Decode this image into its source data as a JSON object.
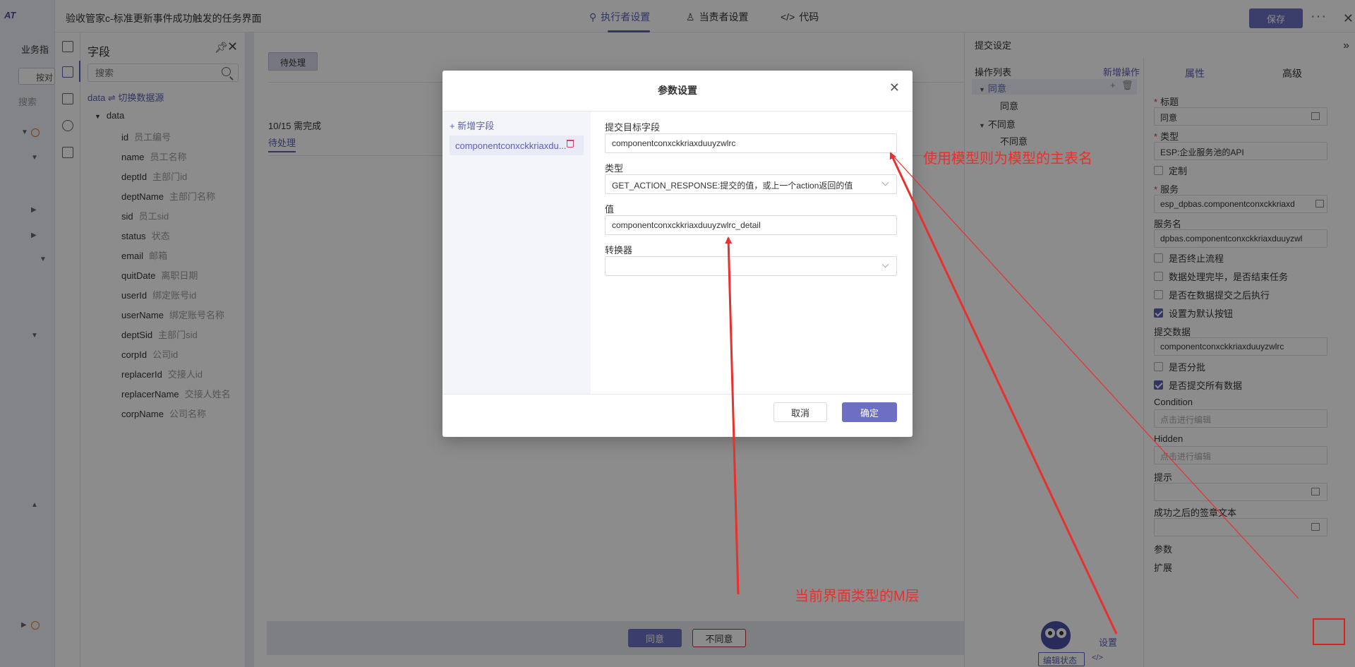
{
  "app": {
    "logo_text": "AT",
    "title": "验收管家c-标准更新事件成功触发的任务界面",
    "tabs": [
      {
        "label": "执行者设置",
        "icon": "executor-icon",
        "active": true
      },
      {
        "label": "当责者设置",
        "icon": "person-icon",
        "active": false
      },
      {
        "label": "代码",
        "icon": "code-icon",
        "active": false
      }
    ],
    "save_label": "保存",
    "more_label": "···",
    "close_label": "✕"
  },
  "left_nav": {
    "section_label": "业务指",
    "button_label": "按对",
    "search_placeholder": "搜索"
  },
  "field_panel": {
    "title": "字段",
    "search_placeholder": "搜索",
    "datasource_label": "data ⇌ 切换数据源",
    "root_label": "data",
    "fields": [
      {
        "name": "id",
        "desc": "员工编号"
      },
      {
        "name": "name",
        "desc": "员工名称"
      },
      {
        "name": "deptId",
        "desc": "主部门id"
      },
      {
        "name": "deptName",
        "desc": "主部门名称"
      },
      {
        "name": "sid",
        "desc": "员工sid"
      },
      {
        "name": "status",
        "desc": "状态"
      },
      {
        "name": "email",
        "desc": "邮箱"
      },
      {
        "name": "quitDate",
        "desc": "离职日期"
      },
      {
        "name": "userId",
        "desc": "绑定账号id"
      },
      {
        "name": "userName",
        "desc": "绑定账号名称"
      },
      {
        "name": "deptSid",
        "desc": "主部门sid"
      },
      {
        "name": "corpId",
        "desc": "公司id"
      },
      {
        "name": "replacerId",
        "desc": "交接人id"
      },
      {
        "name": "replacerName",
        "desc": "交接人姓名"
      },
      {
        "name": "corpName",
        "desc": "公司名称"
      }
    ]
  },
  "canvas": {
    "chip_label": "待处理",
    "progress_text": "10/15 需完成",
    "tab_label": "待处理",
    "agree_label": "同意",
    "disagree_label": "不同意"
  },
  "right_panel": {
    "title": "提交设定",
    "op_list_title": "操作列表",
    "op_add_label": "新增操作",
    "ops": [
      {
        "label": "同意",
        "selected": true
      },
      {
        "label": "同意",
        "child": true
      },
      {
        "label": "不同意",
        "selected": false
      },
      {
        "label": "不同意",
        "child": true
      }
    ],
    "tab_attr": "属性",
    "tab_adv": "高级",
    "title_label": "标题",
    "title_value": "同意",
    "type_label": "类型",
    "type_value": "ESP:企业服务池的API",
    "custom_label": "定制",
    "service_label": "服务",
    "service_value": "esp_dpbas.componentconxckkriaxd",
    "service_name_label": "服务名",
    "service_name_value": "dpbas.componentconxckkriaxduuyzwl",
    "terminate_label": "是否终止流程",
    "finish_task_label": "数据处理完毕，是否结束任务",
    "after_submit_label": "是否在数据提交之后执行",
    "default_btn_label": "设置为默认按钮",
    "submit_data_label": "提交数据",
    "submit_data_value": "componentconxckkriaxduuyzwlrc",
    "split_label": "是否分批",
    "submit_all_label": "是否提交所有数据",
    "condition_label": "Condition",
    "condition_placeholder": "点击进行编辑",
    "hidden_label": "Hidden",
    "hidden_placeholder": "点击进行编辑",
    "hint_label": "提示",
    "success_label": "成功之后的签章文本",
    "params_label": "参数",
    "settings_link": "设置",
    "extend_label": "扩展",
    "edit_state_label": "编辑状态"
  },
  "modal": {
    "title": "参数设置",
    "add_field_label": "+ 新增字段",
    "field_item_label": "componentconxckkriaxdu...",
    "target_label": "提交目标字段",
    "target_value": "componentconxckkriaxduuyzwlrc",
    "type_label": "类型",
    "type_value": "GET_ACTION_RESPONSE:提交的值，或上一个action返回的值",
    "value_label": "值",
    "value_value": "componentconxckkriaxduuyzwlrc_detail",
    "converter_label": "转换器",
    "converter_value": "",
    "cancel_label": "取消",
    "ok_label": "确定"
  },
  "annotations": {
    "main_table_note": "使用模型则为模型的主表名",
    "m_layer_note": "当前界面类型的M层",
    "color": "#e8302e"
  }
}
